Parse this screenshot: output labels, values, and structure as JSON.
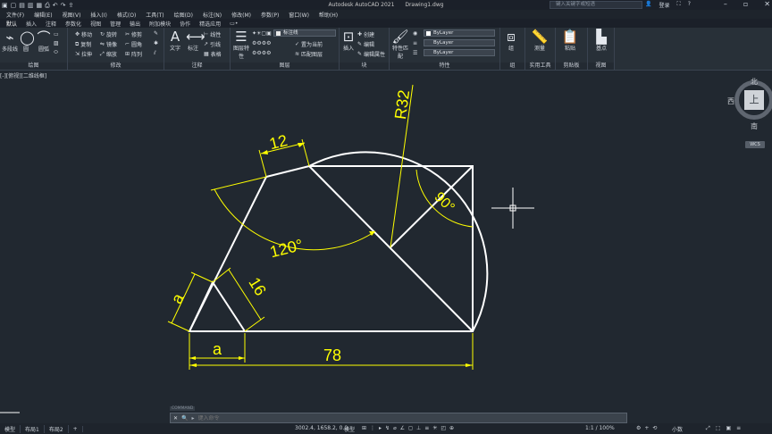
{
  "app": {
    "title": "Autodesk AutoCAD 2021",
    "filename": "Drawing1.dwg",
    "search_placeholder": "键入关键字或短语",
    "user": "登录",
    "qat_icons": [
      "new-icon",
      "open-icon",
      "save-icon",
      "save-as-icon",
      "print-icon",
      "undo-icon",
      "redo-icon",
      "share-icon"
    ]
  },
  "menubar": [
    "文件(F)",
    "编辑(E)",
    "视图(V)",
    "插入(I)",
    "格式(O)",
    "工具(T)",
    "绘图(D)",
    "标注(N)",
    "修改(M)",
    "参数(P)",
    "窗口(W)",
    "帮助(H)"
  ],
  "ribbon_tabs": [
    "默认",
    "插入",
    "注释",
    "参数化",
    "视图",
    "管理",
    "输出",
    "附加模块",
    "协作",
    "精选应用",
    "▭•"
  ],
  "ribbon": {
    "draw": {
      "title": "绘图",
      "polyline": "多段线",
      "circle": "圆",
      "arc": "圆弧"
    },
    "modify": {
      "title": "修改",
      "move": "移动",
      "rotate": "旋转",
      "trim": "修剪",
      "copy": "复制",
      "mirror": "镜像",
      "fillet": "圆角",
      "stretch": "拉伸",
      "scale": "缩放",
      "array": "阵列"
    },
    "annotation": {
      "title": "注释",
      "text": "文字",
      "dimension": "标注",
      "linear": "线性",
      "leader": "引线",
      "table": "表格"
    },
    "layers": {
      "title": "图层",
      "properties": "图层特性",
      "current_layer": "标注线",
      "make_current": "置为当前",
      "match": "匹配图层"
    },
    "block": {
      "title": "块",
      "insert": "插入",
      "create": "创建",
      "edit": "编辑",
      "edit_attr": "编辑属性"
    },
    "properties": {
      "title": "特性",
      "match": "特性匹配",
      "color": "ByLayer",
      "linetype": "ByLayer",
      "lineweight": "ByLayer"
    },
    "groups": {
      "title": "组",
      "group": "组"
    },
    "utilities": {
      "title": "实用工具",
      "measure": "测量"
    },
    "clipboard": {
      "title": "剪贴板",
      "paste": "粘贴"
    },
    "view": {
      "title": "视图",
      "base": "基点"
    }
  },
  "viewport_label": "[-][俯视][二维线框]",
  "viewcube": {
    "north": "北",
    "south": "南",
    "west": "西",
    "face": "上",
    "wcs": "WCS"
  },
  "dimensions": {
    "d12": "12",
    "r32": "R32",
    "d90": "90°",
    "d120": "120°",
    "a_left": "a",
    "a_bottom": "a",
    "d16": "16",
    "d78": "78"
  },
  "command": {
    "label": "COMMAND",
    "placeholder": "键入命令"
  },
  "status": {
    "tabs": [
      "模型",
      "布局1",
      "布局2",
      "+"
    ],
    "coords": "3002.4, 1658.2, 0.0",
    "model": "模型",
    "scale": "1:1 / 100%",
    "units": "小数"
  },
  "colors": {
    "dim": "#ffff00",
    "geometry": "#ffffff",
    "background": "#212830"
  }
}
